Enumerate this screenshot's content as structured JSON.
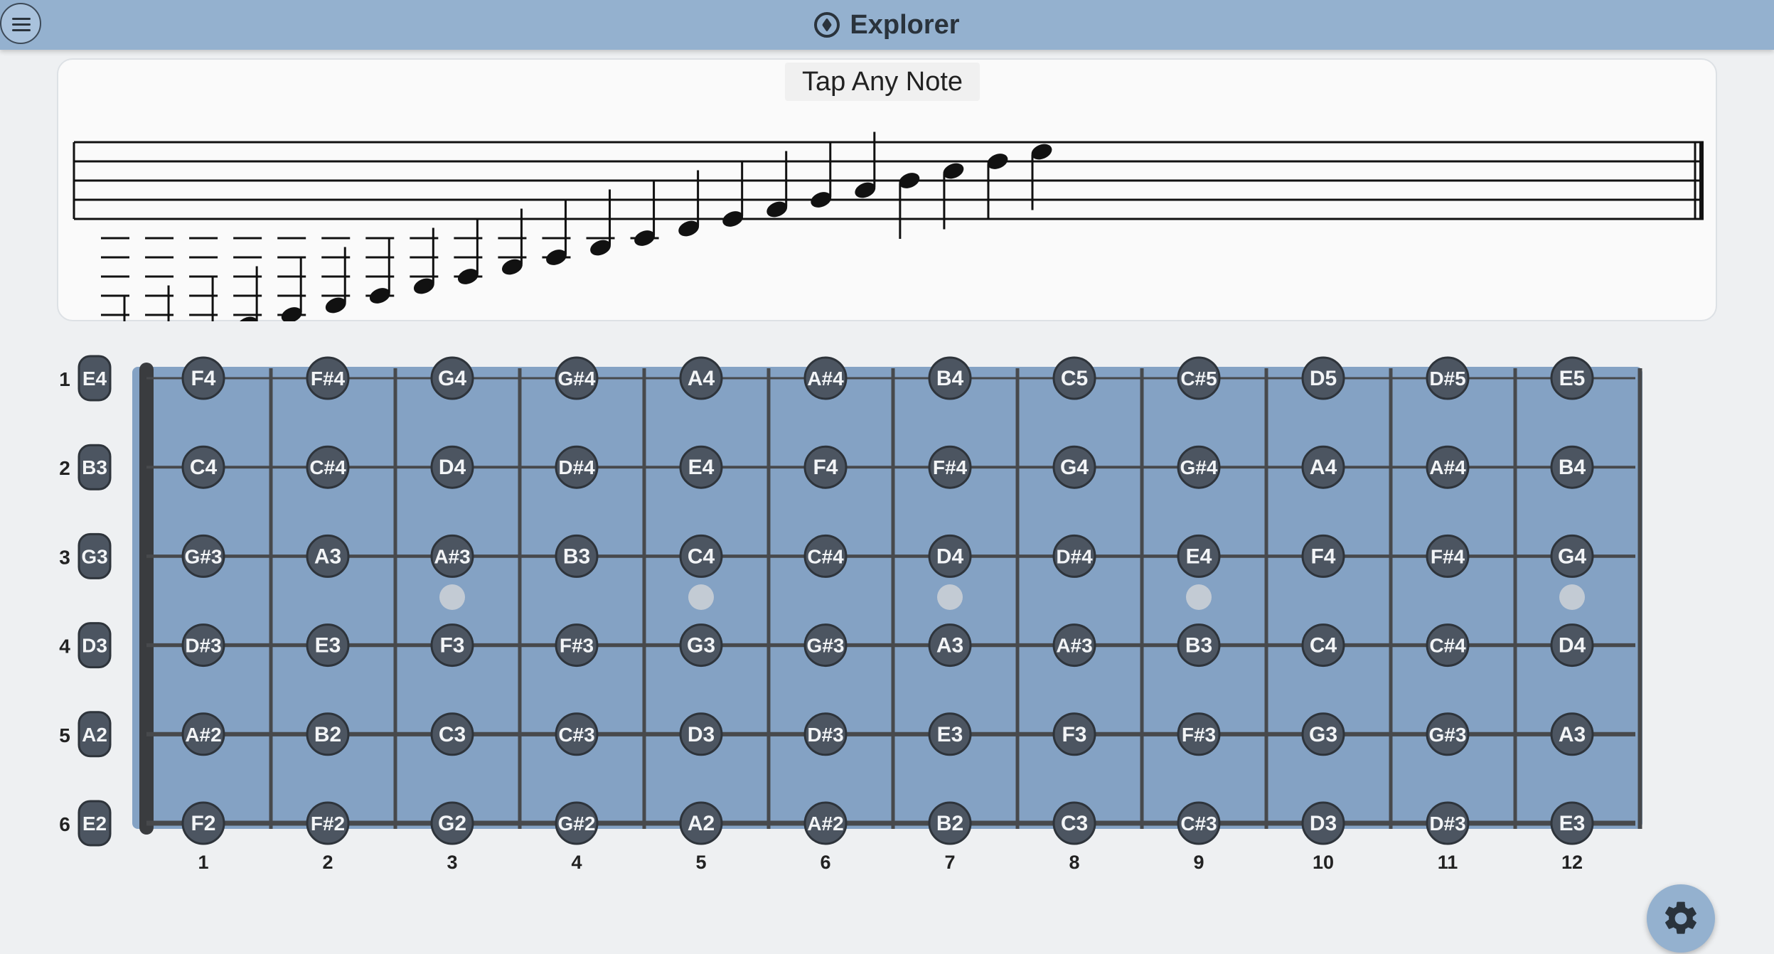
{
  "header": {
    "title": "Explorer",
    "menu_icon": "menu-icon",
    "title_icon": "compass-icon"
  },
  "staff": {
    "prompt": "Tap Any Note",
    "notes": [
      "E2",
      "F2",
      "G2",
      "A2",
      "B2",
      "C3",
      "D3",
      "E3",
      "F3",
      "G3",
      "A3",
      "B3",
      "C4",
      "D4",
      "E4",
      "F4",
      "G4",
      "A4",
      "B4",
      "C5",
      "D5",
      "E5"
    ]
  },
  "fretboard": {
    "colors": {
      "board": "#84a2c4",
      "note_fill": "#4c5561",
      "string": "#47494c",
      "nut": "#3a3c3f",
      "marker": "#c3cbd4"
    },
    "strings": [
      {
        "number": "1",
        "open": "E4",
        "notes": [
          "F4",
          "F#4",
          "G4",
          "G#4",
          "A4",
          "A#4",
          "B4",
          "C5",
          "C#5",
          "D5",
          "D#5",
          "E5"
        ]
      },
      {
        "number": "2",
        "open": "B3",
        "notes": [
          "C4",
          "C#4",
          "D4",
          "D#4",
          "E4",
          "F4",
          "F#4",
          "G4",
          "G#4",
          "A4",
          "A#4",
          "B4"
        ]
      },
      {
        "number": "3",
        "open": "G3",
        "notes": [
          "G#3",
          "A3",
          "A#3",
          "B3",
          "C4",
          "C#4",
          "D4",
          "D#4",
          "E4",
          "F4",
          "F#4",
          "G4"
        ]
      },
      {
        "number": "4",
        "open": "D3",
        "notes": [
          "D#3",
          "E3",
          "F3",
          "F#3",
          "G3",
          "G#3",
          "A3",
          "A#3",
          "B3",
          "C4",
          "C#4",
          "D4"
        ]
      },
      {
        "number": "5",
        "open": "A2",
        "notes": [
          "A#2",
          "B2",
          "C3",
          "C#3",
          "D3",
          "D#3",
          "E3",
          "F3",
          "F#3",
          "G3",
          "G#3",
          "A3"
        ]
      },
      {
        "number": "6",
        "open": "E2",
        "notes": [
          "F2",
          "F#2",
          "G2",
          "G#2",
          "A2",
          "A#2",
          "B2",
          "C3",
          "C#3",
          "D3",
          "D#3",
          "E3"
        ]
      }
    ],
    "fret_numbers": [
      "1",
      "2",
      "3",
      "4",
      "5",
      "6",
      "7",
      "8",
      "9",
      "10",
      "11",
      "12"
    ],
    "marker_frets": [
      3,
      5,
      7,
      9,
      12
    ]
  },
  "settings": {
    "icon": "gear-icon"
  }
}
